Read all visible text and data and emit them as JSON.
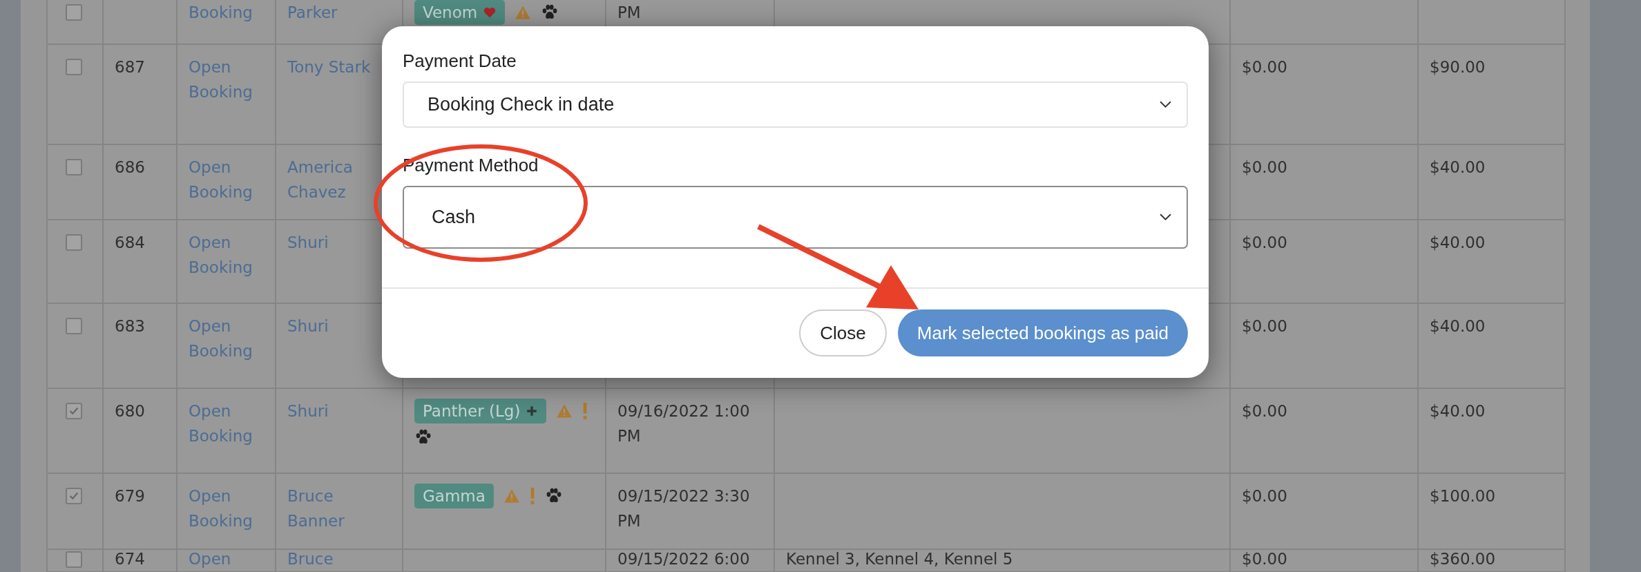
{
  "table": {
    "rows": [
      {
        "checked": false,
        "id": "",
        "link": "Booking",
        "name": "Parker",
        "badge": {
          "label": "Venom",
          "kind": "heart"
        },
        "warning": true,
        "alert": false,
        "pet": true,
        "date": "PM",
        "notes": "",
        "paid": "",
        "total": ""
      },
      {
        "checked": false,
        "id": "687",
        "link": "Open Booking",
        "name": "Tony Stark",
        "paid": "$0.00",
        "total": "$90.00"
      },
      {
        "checked": false,
        "id": "686",
        "link": "Open Booking",
        "name": "America Chavez",
        "paid": "$0.00",
        "total": "$40.00"
      },
      {
        "checked": false,
        "id": "684",
        "link": "Open Booking",
        "name": "Shuri",
        "paid": "$0.00",
        "total": "$40.00"
      },
      {
        "checked": false,
        "id": "683",
        "link": "Open Booking",
        "name": "Shuri",
        "paid": "$0.00",
        "total": "$40.00"
      },
      {
        "checked": true,
        "id": "680",
        "link": "Open Booking",
        "name": "Shuri",
        "badge": {
          "label": "Panther (Lg)",
          "kind": "plus"
        },
        "warning": true,
        "alert": true,
        "pet": true,
        "date": "09/16/2022 1:00 PM",
        "paid": "$0.00",
        "total": "$40.00"
      },
      {
        "checked": true,
        "id": "679",
        "link": "Open Booking",
        "name": "Bruce Banner",
        "badge": {
          "label": "Gamma",
          "kind": "none"
        },
        "warning": true,
        "alert": true,
        "pet": true,
        "date": "09/15/2022 3:30 PM",
        "paid": "$0.00",
        "total": "$100.00"
      },
      {
        "checked": false,
        "id": "674",
        "link": "Open",
        "name": "Bruce",
        "date": "09/15/2022 6:00",
        "notes": "Kennel 3, Kennel 4, Kennel 5",
        "paid": "$0.00",
        "total": "$360.00"
      }
    ]
  },
  "modal": {
    "fields": [
      {
        "label": "Payment Date",
        "value": "Booking Check in date",
        "focused": false
      },
      {
        "label": "Payment Method",
        "value": "Cash",
        "focused": true
      }
    ],
    "buttons": [
      {
        "label": "Close",
        "kind": "secondary"
      },
      {
        "label": "Mark selected bookings as paid",
        "kind": "primary"
      }
    ]
  }
}
